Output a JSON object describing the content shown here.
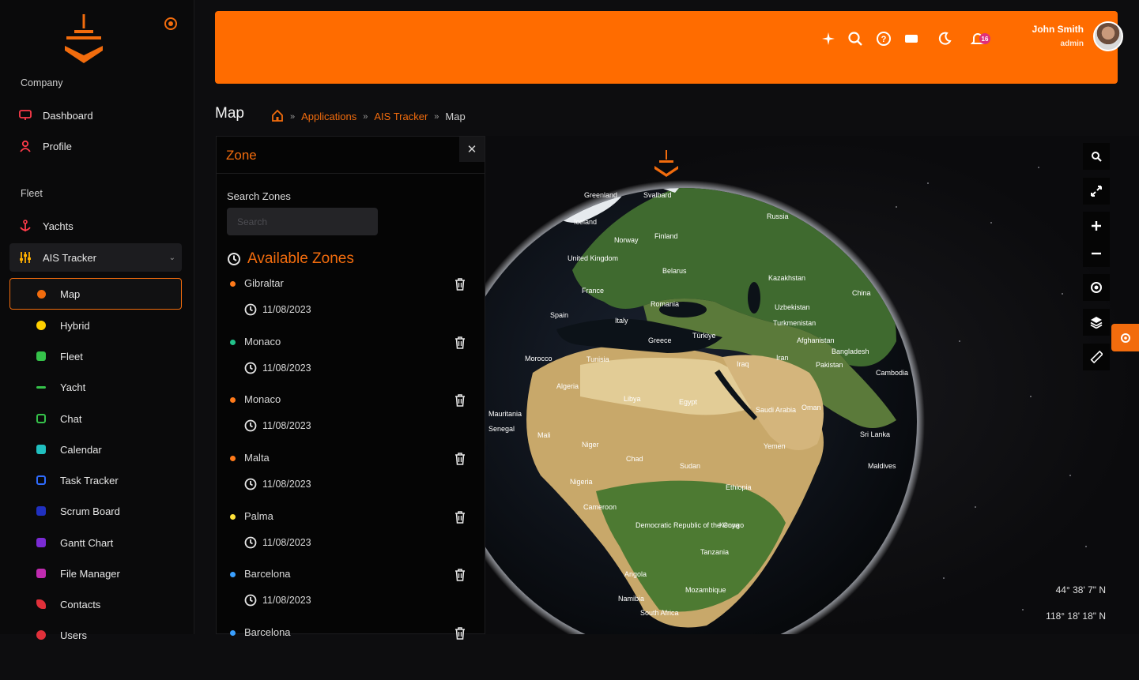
{
  "sidebar": {
    "section_company": "Company",
    "section_fleet": "Fleet",
    "company_items": [
      {
        "label": "Dashboard",
        "icon": "monitor-icon",
        "color": "#ff3b4a"
      },
      {
        "label": "Profile",
        "icon": "user-icon",
        "color": "#ff3b4a"
      }
    ],
    "fleet_items": [
      {
        "label": "Yachts",
        "icon": "anchor-icon",
        "color": "#ff3b4a"
      },
      {
        "label": "AIS Tracker",
        "icon": "sliders-icon",
        "color": "#ffb000"
      }
    ],
    "sub_items": [
      {
        "label": "Map",
        "icon": "compass-icon",
        "color": "#f26c0d"
      },
      {
        "label": "Hybrid",
        "icon": "gear-icon",
        "color": "#ffd000"
      },
      {
        "label": "Fleet",
        "icon": "file-icon",
        "color": "#35c24a"
      },
      {
        "label": "Yacht",
        "icon": "boat-icon",
        "color": "#35c24a"
      },
      {
        "label": "Chat",
        "icon": "chat-icon",
        "color": "#35c24a"
      },
      {
        "label": "Calendar",
        "icon": "calendar-icon",
        "color": "#20c0c0"
      },
      {
        "label": "Task Tracker",
        "icon": "clipboard-icon",
        "color": "#2f6cff"
      },
      {
        "label": "Scrum Board",
        "icon": "board-icon",
        "color": "#2030c0"
      },
      {
        "label": "Gantt Chart",
        "icon": "gantt-icon",
        "color": "#7a2bd4"
      },
      {
        "label": "File Manager",
        "icon": "folder-icon",
        "color": "#c02bb0"
      },
      {
        "label": "Contacts",
        "icon": "phone-icon",
        "color": "#e0303a"
      },
      {
        "label": "Users",
        "icon": "users-icon",
        "color": "#e0303a"
      }
    ]
  },
  "header": {
    "notification_count": "16",
    "user_name": "John Smith",
    "user_role": "admin"
  },
  "page": {
    "title": "Map",
    "breadcrumb": [
      "Applications",
      "AIS Tracker",
      "Map"
    ]
  },
  "zone_panel": {
    "title": "Zone",
    "search_label": "Search Zones",
    "search_placeholder": "Search",
    "available_title": "Available Zones",
    "zones": [
      {
        "name": "Gibraltar",
        "date": "11/08/2023",
        "color": "#ff7a1a"
      },
      {
        "name": "Monaco",
        "date": "11/08/2023",
        "color": "#22c28a"
      },
      {
        "name": "Monaco",
        "date": "11/08/2023",
        "color": "#ff7a1a"
      },
      {
        "name": "Malta",
        "date": "11/08/2023",
        "color": "#ff7a1a"
      },
      {
        "name": "Palma",
        "date": "11/08/2023",
        "color": "#ffe23a"
      },
      {
        "name": "Barcelona",
        "date": "11/08/2023",
        "color": "#3aa0ff"
      },
      {
        "name": "Barcelona",
        "date": "",
        "color": "#3aa0ff"
      }
    ]
  },
  "map": {
    "labels": {
      "svalbard": "Svalbard",
      "greenland": "Greenland",
      "iceland": "Iceland",
      "russia": "Russia",
      "norway": "Norway",
      "finland": "Finland",
      "uk": "United Kingdom",
      "belarus": "Belarus",
      "kazakhstan": "Kazakhstan",
      "china": "China",
      "france": "France",
      "romania": "Romania",
      "spain": "Spain",
      "italy": "Italy",
      "uzbekistan": "Uzbekistan",
      "turkmenistan": "Turkmenistan",
      "greece": "Greece",
      "turkiye": "Türkiye",
      "afghanistan": "Afghanistan",
      "bangladesh": "Bangladesh",
      "morocco": "Morocco",
      "tunisia": "Tunisia",
      "iraq": "Iraq",
      "iran": "Iran",
      "pakistan": "Pakistan",
      "cambodia": "Cambodia",
      "algeria": "Algeria",
      "libya": "Libya",
      "egypt": "Egypt",
      "saudi": "Saudi Arabia",
      "oman": "Oman",
      "mauritania": "Mauritania",
      "senegal": "Senegal",
      "mali": "Mali",
      "niger": "Niger",
      "yemen": "Yemen",
      "srilanka": "Sri Lanka",
      "chad": "Chad",
      "sudan": "Sudan",
      "maldives": "Maldives",
      "nigeria": "Nigeria",
      "ethiopia": "Ethiopia",
      "cameroon": "Cameroon",
      "kenya": "Kenya",
      "drc": "Democratic Republic of the Congo",
      "tanzania": "Tanzania",
      "angola": "Angola",
      "mozambique": "Mozambique",
      "namibia": "Namibia",
      "southafrica": "South Africa"
    },
    "coord_lat": "44° 38' 7\" N",
    "coord_lon": "118° 18' 18\" N"
  }
}
